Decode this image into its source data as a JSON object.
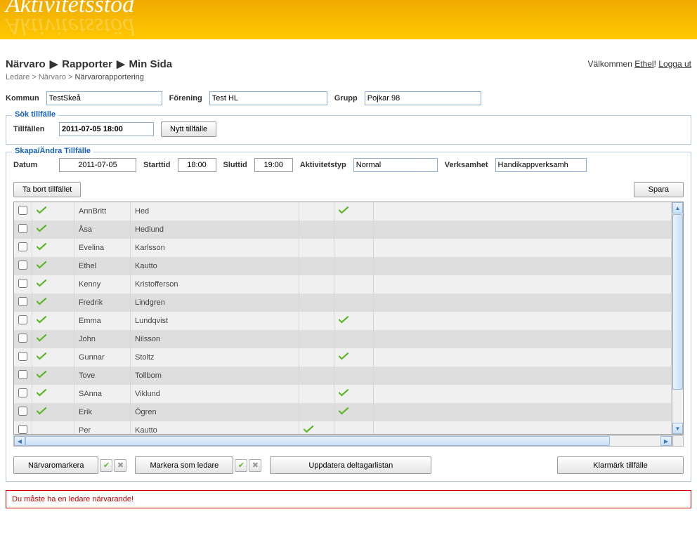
{
  "banner": {
    "title": "Aktivitetsstöd"
  },
  "nav": {
    "tabs": [
      "Närvaro",
      "Rapporter",
      "Min Sida"
    ],
    "welcome_prefix": "Välkommen ",
    "welcome_user": "Ethel",
    "welcome_suffix": "! ",
    "logout": "Logga ut"
  },
  "crumbs": {
    "a": "Ledare",
    "b": "Närvaro",
    "c": "Närvarorapportering"
  },
  "filters": {
    "kommun_lbl": "Kommun",
    "kommun_val": "TestSkeå",
    "forening_lbl": "Förening",
    "forening_val": "Test HL",
    "grupp_lbl": "Grupp",
    "grupp_val": "Pojkar 98"
  },
  "sok": {
    "legend": "Sök tillfälle",
    "tillfallen_lbl": "Tillfällen",
    "tillfallen_val": "2011-07-05 18:00",
    "nytt_btn": "Nytt tillfälle"
  },
  "skapa": {
    "legend": "Skapa/Ändra Tillfälle",
    "datum_lbl": "Datum",
    "datum_val": "2011-07-05",
    "start_lbl": "Starttid",
    "start_val": "18:00",
    "slut_lbl": "Sluttid",
    "slut_val": "19:00",
    "aktiv_lbl": "Aktivitetstyp",
    "aktiv_val": "Normal",
    "verks_lbl": "Verksamhet",
    "verks_val": "Handikappverksamh",
    "tabort_btn": "Ta bort tillfället",
    "spara_btn": "Spara"
  },
  "rows": [
    {
      "first": "AnnBritt",
      "last": "Hed",
      "c1": true,
      "c4": false,
      "c5": true
    },
    {
      "first": "Åsa",
      "last": "Hedlund",
      "c1": true,
      "c4": false,
      "c5": false
    },
    {
      "first": "Evelina",
      "last": "Karlsson",
      "c1": true,
      "c4": false,
      "c5": false
    },
    {
      "first": "Ethel",
      "last": "Kautto",
      "c1": true,
      "c4": false,
      "c5": false
    },
    {
      "first": "Kenny",
      "last": "Kristofferson",
      "c1": true,
      "c4": false,
      "c5": false
    },
    {
      "first": "Fredrik",
      "last": "Lindgren",
      "c1": true,
      "c4": false,
      "c5": false
    },
    {
      "first": "Emma",
      "last": "Lundqvist",
      "c1": true,
      "c4": false,
      "c5": true
    },
    {
      "first": "John",
      "last": "Nilsson",
      "c1": true,
      "c4": false,
      "c5": false
    },
    {
      "first": "Gunnar",
      "last": "Stoltz",
      "c1": true,
      "c4": false,
      "c5": true
    },
    {
      "first": "Tove",
      "last": "Tollbom",
      "c1": true,
      "c4": false,
      "c5": false
    },
    {
      "first": "SAnna",
      "last": "Viklund",
      "c1": true,
      "c4": false,
      "c5": true
    },
    {
      "first": "Erik",
      "last": "Ögren",
      "c1": true,
      "c4": false,
      "c5": true
    },
    {
      "first": "Per",
      "last": "Kautto",
      "c1": false,
      "c4": true,
      "c5": false
    }
  ],
  "bottom": {
    "narvaro_btn": "Närvaromarkera",
    "markera_btn": "Markera som ledare",
    "uppdatera_btn": "Uppdatera deltagarlistan",
    "klarmarkt_btn": "Klarmärk tillfälle"
  },
  "msg": "Du måste ha en ledare närvarande!"
}
